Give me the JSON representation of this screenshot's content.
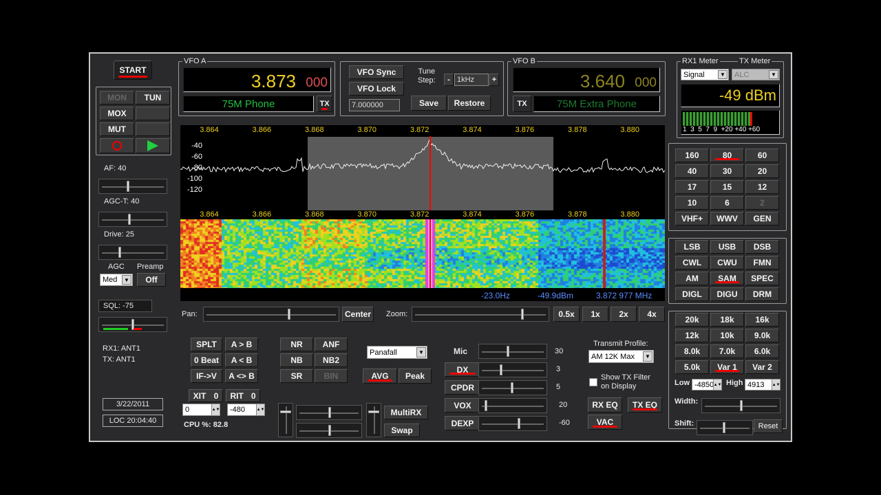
{
  "start_label": "START",
  "mode_buttons": {
    "mon": "MON",
    "tun": "TUN",
    "mox": "MOX",
    "mut": "MUT"
  },
  "sliders": {
    "af": "AF:  40",
    "agct": "AGC-T:  40",
    "drive": "Drive:  25"
  },
  "agc": {
    "label": "AGC",
    "value": "Med",
    "preamp_label": "Preamp",
    "preamp_value": "Off"
  },
  "sql": {
    "label": "SQL:  -75"
  },
  "antennas": {
    "rx": "RX1: ANT1",
    "tx": "TX: ANT1"
  },
  "date": "3/22/2011",
  "time": "LOC 20:04:40",
  "vfo_a": {
    "title": "VFO A",
    "freq_main": "3.873",
    "freq_sub": "000",
    "band": "75M Phone",
    "tx": "TX"
  },
  "vfo_mid": {
    "sync": "VFO Sync",
    "lock": "VFO Lock",
    "tune_label": "Tune\nStep:",
    "step_minus": "-",
    "step": "1kHz",
    "step_plus": "+",
    "freq_field": "7.000000",
    "save": "Save",
    "restore": "Restore"
  },
  "vfo_b": {
    "title": "VFO B",
    "freq_main": "3.640",
    "freq_sub": "000",
    "band": "75M Extra Phone",
    "tx": "TX"
  },
  "meter": {
    "rx_title": "RX1 Meter",
    "tx_title": "TX Meter",
    "rx_sel": "Signal",
    "tx_sel": "ALC",
    "reading": "-49 dBm",
    "scale": "1  3  5  7  9  +20 +40 +60",
    "level_pct": 70
  },
  "freq_axis": [
    "3.864",
    "3.866",
    "3.868",
    "3.870",
    "3.872",
    "3.874",
    "3.876",
    "3.878",
    "3.880",
    "3.88"
  ],
  "db_axis": [
    "-40",
    "-60",
    "-80",
    "-100",
    "-120"
  ],
  "readout": {
    "offset": "-23.0Hz",
    "level": "-49.9dBm",
    "freq": "3.872 977 MHz"
  },
  "pan": {
    "label": "Pan:",
    "center": "Center",
    "zoom_label": "Zoom:",
    "z05": "0.5x",
    "z1": "1x",
    "z2": "2x",
    "z4": "4x"
  },
  "bands": [
    "160",
    "80",
    "60",
    "40",
    "30",
    "20",
    "17",
    "15",
    "12",
    "10",
    "6",
    "2",
    "VHF+",
    "WWV",
    "GEN"
  ],
  "modes": [
    "LSB",
    "USB",
    "DSB",
    "CWL",
    "CWU",
    "FMN",
    "AM",
    "SAM",
    "SPEC",
    "DIGL",
    "DIGU",
    "DRM"
  ],
  "filters": [
    "20k",
    "18k",
    "16k",
    "12k",
    "10k",
    "9.0k",
    "8.0k",
    "7.0k",
    "6.0k",
    "5.0k",
    "Var 1",
    "Var 2"
  ],
  "filter_edge": {
    "low_label": "Low",
    "low": "-4850",
    "high_label": "High",
    "high": "4913",
    "width_label": "Width:",
    "shift_label": "Shift:",
    "reset": "Reset"
  },
  "split": {
    "splt": "SPLT",
    "a_to_b": "A > B",
    "zero_beat": "0 Beat",
    "b_to_a": "A < B",
    "if_v": "IF->V",
    "swap": "A <> B"
  },
  "xit": {
    "label": "XIT",
    "state": "0",
    "value": "0"
  },
  "rit": {
    "label": "RIT",
    "state": "0",
    "value": "-480"
  },
  "cpu": "CPU %:  82.8",
  "dsp": {
    "nr": "NR",
    "anf": "ANF",
    "nb": "NB",
    "nb2": "NB2",
    "sr": "SR",
    "bin": "BIN"
  },
  "display": {
    "mode": "Panafall",
    "avg": "AVG",
    "peak": "Peak"
  },
  "multirx": {
    "multirx": "MultiRX",
    "swap": "Swap"
  },
  "tx_controls": {
    "mic": "Mic",
    "mic_val": "30",
    "dx": "DX",
    "dx_val": "3",
    "cpdr": "CPDR",
    "cpdr_val": "5",
    "vox": "VOX",
    "vox_val": "20",
    "dexp": "DEXP",
    "dexp_val": "-60"
  },
  "tx_profile": {
    "label": "Transmit Profile:",
    "value": "AM 12K Max",
    "show_filter": "Show TX Filter\non Display",
    "rx_eq": "RX EQ",
    "tx_eq": "TX EQ",
    "vac": "VAC"
  },
  "colors": {
    "freq_yellow": "#f0d020",
    "band_green": "#20c040",
    "marker_red": "#ff0000",
    "readout_blue": "#5a8cff"
  }
}
